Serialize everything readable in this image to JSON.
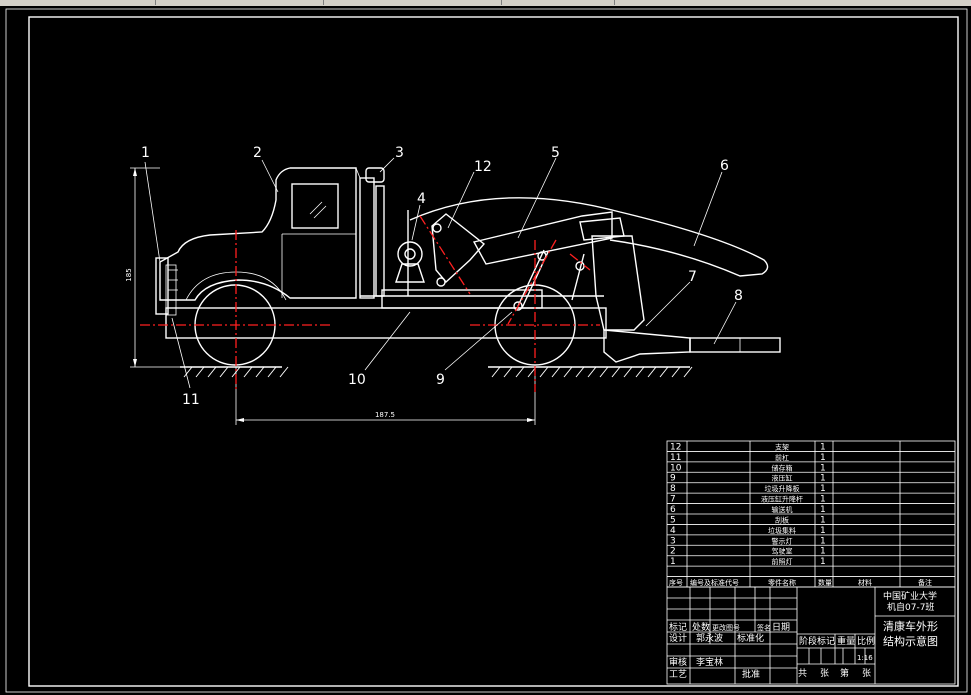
{
  "callouts": [
    "1",
    "2",
    "3",
    "4",
    "5",
    "6",
    "7",
    "8",
    "9",
    "10",
    "11",
    "12"
  ],
  "dimensions": {
    "height": "185",
    "wheelbase": "187.5"
  },
  "parts_list": [
    {
      "no": "12",
      "name": "支架",
      "qty": "1"
    },
    {
      "no": "11",
      "name": "前杠",
      "qty": "1"
    },
    {
      "no": "10",
      "name": "储存箱",
      "qty": "1"
    },
    {
      "no": "9",
      "name": "液压缸",
      "qty": "1"
    },
    {
      "no": "8",
      "name": "垃圾升降板",
      "qty": "1"
    },
    {
      "no": "7",
      "name": "液压缸升降杆",
      "qty": "1"
    },
    {
      "no": "6",
      "name": "输送机",
      "qty": "1"
    },
    {
      "no": "5",
      "name": "刮板",
      "qty": "1"
    },
    {
      "no": "4",
      "name": "垃圾集料",
      "qty": "1"
    },
    {
      "no": "3",
      "name": "警示灯",
      "qty": "1"
    },
    {
      "no": "2",
      "name": "驾驶室",
      "qty": "1"
    },
    {
      "no": "1",
      "name": "前照灯",
      "qty": "1"
    }
  ],
  "parts_header": {
    "no": "序号",
    "code": "编号及标准代号",
    "name": "零件名称",
    "qty": "数量",
    "material": "材料",
    "remark": "备注"
  },
  "title_block": {
    "school": "中国矿业大学",
    "class": "机自07-7班",
    "title_line1": "清康车外形",
    "title_line2": "结构示意图",
    "scale": "1:16",
    "rev_headers": [
      "标记",
      "处数",
      "更改图号",
      "签名",
      "日期"
    ],
    "design_label": "设计",
    "designer": "郭永波",
    "std_label": "标准化",
    "review_label": "审核",
    "reviewer": "李宝林",
    "process_label": "工艺",
    "approve_label": "批准",
    "stage_label": "阶段标记",
    "weight_label": "重量",
    "scale_label": "比例",
    "sheets_total": "共",
    "sheet_unit": "张",
    "sheet_no": "第",
    "sheet_unit2": "张"
  }
}
